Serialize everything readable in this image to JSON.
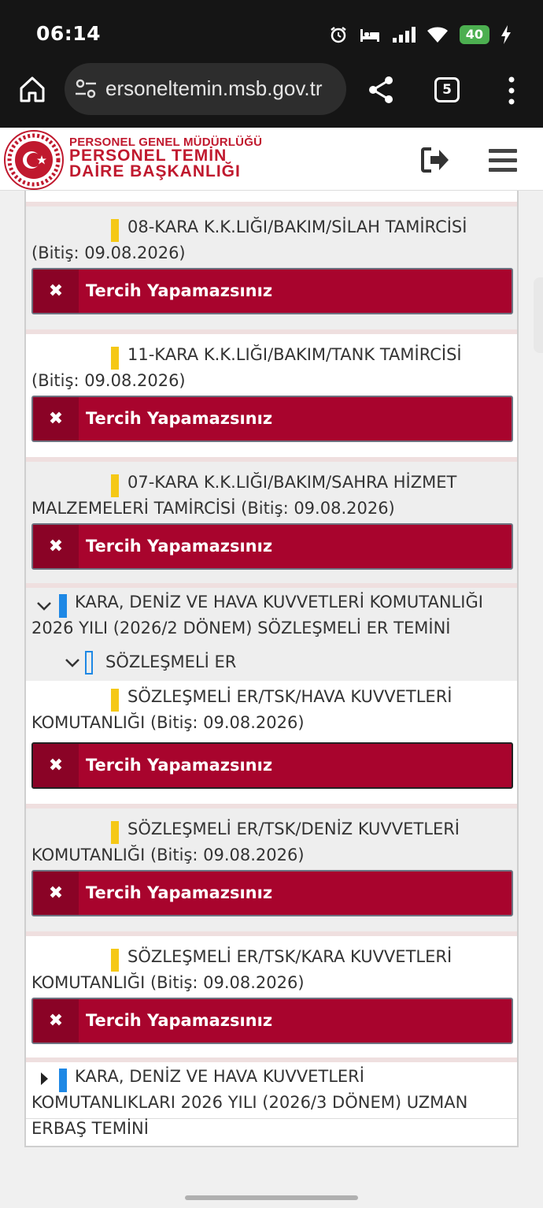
{
  "status_bar": {
    "time": "06:14",
    "battery": "40",
    "icons": [
      "alarm-icon",
      "sleep-mode-icon",
      "signal-icon",
      "wifi-icon",
      "battery-icon",
      "charging-icon"
    ]
  },
  "browser": {
    "url": "ersoneltemin.msb.gov.tr",
    "tab_count": "5",
    "icons": [
      "home-icon",
      "site-settings-icon",
      "share-icon",
      "tabs-icon",
      "more-vert-icon"
    ]
  },
  "site_header": {
    "logo_line1": "PERSONEL GENEL MÜDÜRLÜĞÜ",
    "logo_line2": "PERSONEL TEMİN",
    "logo_line3": "DAİRE BAŞKANLIĞI",
    "icons": [
      "logout-icon",
      "hamburger-menu-icon"
    ]
  },
  "items": [
    {
      "text": "08-KARA K.K.LIĞI/BAKIM/SİLAH TAMİRCİSİ (Bitiş: 09.08.2026)",
      "button": "Tercih Yapamazsınız"
    },
    {
      "text": "11-KARA K.K.LIĞI/BAKIM/TANK TAMİRCİSİ (Bitiş: 09.08.2026)",
      "button": "Tercih Yapamazsınız"
    },
    {
      "text": "07-KARA K.K.LIĞI/BAKIM/SAHRA HİZMET MALZEMELERİ TAMİRCİSİ (Bitiş: 09.08.2026)",
      "button": "Tercih Yapamazsınız"
    }
  ],
  "group": {
    "title": "KARA, DENİZ VE HAVA KUVVETLERİ KOMUTANLIĞI 2026 YILI (2026/2 DÖNEM) SÖZLEŞMELİ ER TEMİNİ",
    "subgroup": "SÖZLEŞMELİ ER",
    "items": [
      {
        "text": "SÖZLEŞMELİ ER/TSK/HAVA KUVVETLERİ KOMUTANLIĞI (Bitiş: 09.08.2026)",
        "button": "Tercih Yapamazsınız"
      },
      {
        "text": "SÖZLEŞMELİ ER/TSK/DENİZ KUVVETLERİ KOMUTANLIĞI (Bitiş: 09.08.2026)",
        "button": "Tercih Yapamazsınız"
      },
      {
        "text": "SÖZLEŞMELİ ER/TSK/KARA KUVVETLERİ KOMUTANLIĞI (Bitiş: 09.08.2026)",
        "button": "Tercih Yapamazsınız"
      }
    ]
  },
  "collapsed_group": {
    "title": "KARA, DENİZ VE HAVA KUVVETLERİ KOMUTANLIKLARI 2026 YILI (2026/3 DÖNEM) UZMAN ERBAŞ TEMİNİ"
  },
  "colors": {
    "button_bg": "#a8042d",
    "button_x_bg": "#8a0326",
    "logo_red": "#c0192e",
    "yellow_marker": "#f5c816",
    "blue_marker": "#1e88e5"
  }
}
